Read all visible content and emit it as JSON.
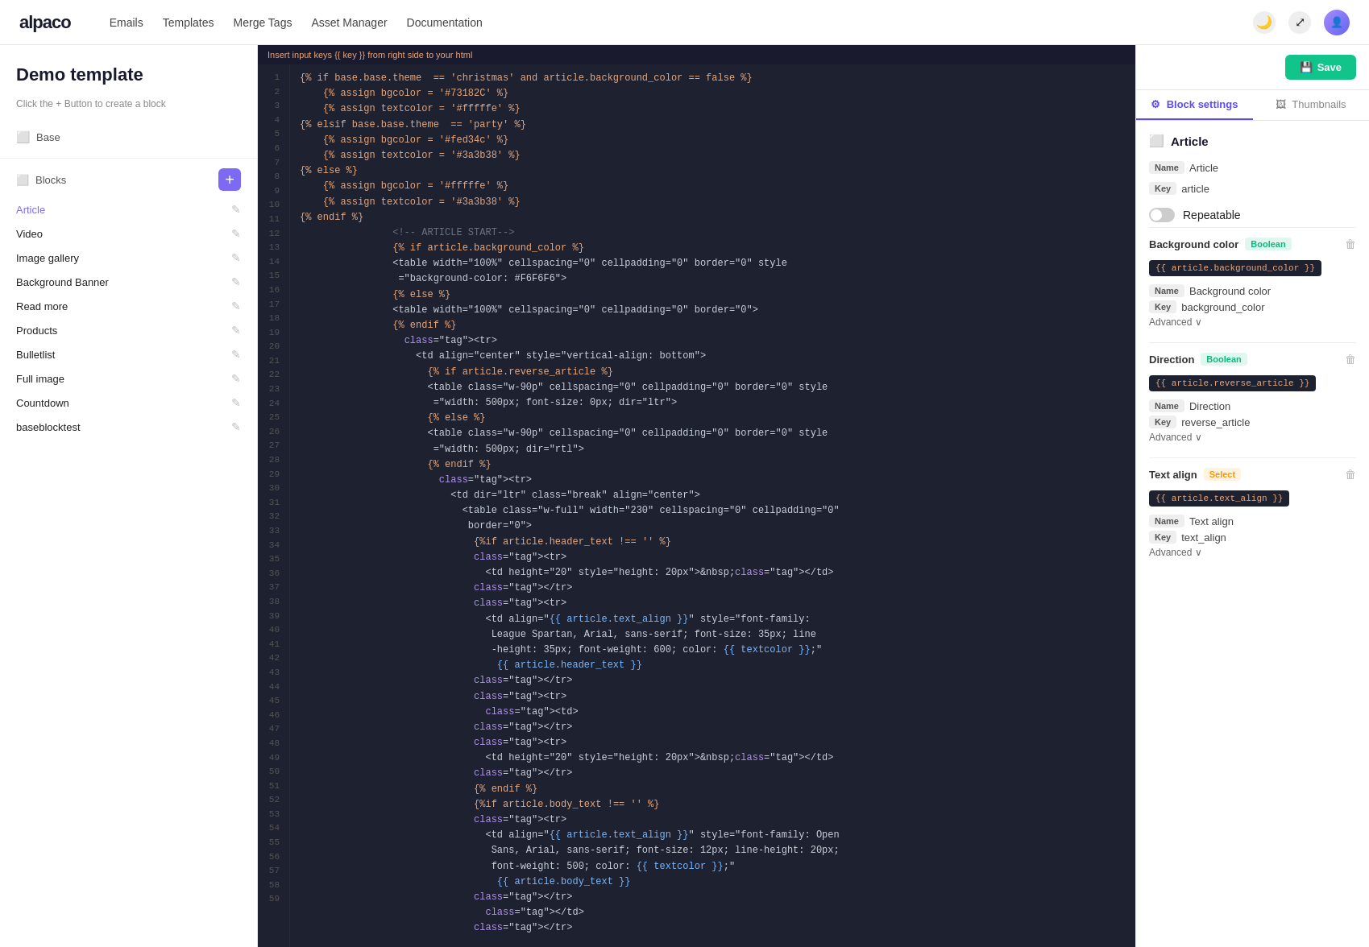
{
  "app": {
    "logo": "alpaco",
    "nav": {
      "links": [
        "Emails",
        "Templates",
        "Merge Tags",
        "Asset Manager",
        "Documentation"
      ]
    }
  },
  "sidebar": {
    "page_title": "Demo template",
    "hint": "Click the + Button to create a block",
    "base_label": "Base",
    "blocks_label": "Blocks",
    "add_button_label": "+",
    "items": [
      {
        "name": "Article",
        "active": true
      },
      {
        "name": "Video",
        "active": false
      },
      {
        "name": "Image gallery",
        "active": false
      },
      {
        "name": "Background Banner",
        "active": false
      },
      {
        "name": "Read more",
        "active": false
      },
      {
        "name": "Products",
        "active": false
      },
      {
        "name": "Bulletlist",
        "active": false
      },
      {
        "name": "Full image",
        "active": false
      },
      {
        "name": "Countdown",
        "active": false
      },
      {
        "name": "baseblocktest",
        "active": false
      }
    ]
  },
  "editor": {
    "hint": "Insert input keys {{ key }} from right side to your html",
    "lines": [
      "{% if base.base.theme  == 'christmas' and article.background_color == false %}",
      "    {% assign bgcolor = '#73182C' %}",
      "    {% assign textcolor = '#fffffe' %}",
      "",
      "{% elsif base.base.theme  == 'party' %}",
      "    {% assign bgcolor = '#fed34c' %}",
      "    {% assign textcolor = '#3a3b38' %}",
      "",
      "{% else %}",
      "    {% assign bgcolor = '#fffffe' %}",
      "    {% assign textcolor = '#3a3b38' %}",
      "{% endif %}",
      "",
      "                <!-- ARTICLE START-->",
      "                {% if article.background_color %}",
      "                <table width=\"100%\" cellspacing=\"0\" cellpadding=\"0\" border=\"0\" style",
      "                 =\"background-color: #F6F6F6\">",
      "                {% else %}",
      "                <table width=\"100%\" cellspacing=\"0\" cellpadding=\"0\" border=\"0\">",
      "                {% endif %}",
      "                  <tr>",
      "                    <td align=\"center\" style=\"vertical-align: bottom\">",
      "                      {% if article.reverse_article %}",
      "                      <table class=\"w-90p\" cellspacing=\"0\" cellpadding=\"0\" border=\"0\" style",
      "                       =\"width: 500px; font-size: 0px; dir=\"ltr\">",
      "                      {% else %}",
      "                      <table class=\"w-90p\" cellspacing=\"0\" cellpadding=\"0\" border=\"0\" style",
      "                       =\"width: 500px; dir=\"rtl\">",
      "                      {% endif %}",
      "                        <tr>",
      "                          <td dir=\"ltr\" class=\"break\" align=\"center\">",
      "                            <table class=\"w-full\" width=\"230\" cellspacing=\"0\" cellpadding=\"0\"",
      "                             border=\"0\">",
      "                              {%if article.header_text !== '' %}",
      "                              <tr>",
      "                                <td height=\"20\" style=\"height: 20px\">&nbsp;</td>",
      "                              </tr>",
      "                              <tr>",
      "                                <td align=\"{{ article.text_align }}\" style=\"font-family:",
      "                                 League Spartan, Arial, sans-serif; font-size: 35px; line",
      "                                 -height: 35px; font-weight: 600; color: {{ textcolor }};\"",
      "                                  {{ article.header_text }}",
      "                              </tr>",
      "                              <tr>",
      "                                <td>",
      "                              </tr>",
      "                              <tr>",
      "                                <td height=\"20\" style=\"height: 20px\">&nbsp;</td>",
      "                              </tr>",
      "                              {% endif %}",
      "                              {%if article.body_text !== '' %}",
      "                              <tr>",
      "                                <td align=\"{{ article.text_align }}\" style=\"font-family: Open",
      "                                 Sans, Arial, sans-serif; font-size: 12px; line-height: 20px;",
      "                                 font-weight: 500; color: {{ textcolor }};\"",
      "                                  {{ article.body_text }}",
      "                              </tr>",
      "                                </td>",
      "                              </tr>"
    ]
  },
  "right_panel": {
    "save_label": "Save",
    "tabs": [
      {
        "label": "Block settings",
        "icon": "⚙",
        "active": true
      },
      {
        "label": "Thumbnails",
        "icon": "🖼",
        "active": false
      }
    ],
    "article_section": {
      "title": "Article",
      "name_label": "Name",
      "name_value": "Article",
      "key_label": "Key",
      "key_value": "article",
      "repeatable_label": "Repeatable"
    },
    "inputs": [
      {
        "id": "background_color",
        "title": "Background color",
        "type_badge": "Boolean",
        "tpl_tag": "{{ article.background_color }}",
        "name_label": "Name",
        "name_value": "Background color",
        "key_label": "Key",
        "key_value": "background_color",
        "advanced_label": "Advanced ∨"
      },
      {
        "id": "direction",
        "title": "Direction",
        "type_badge": "Boolean",
        "tpl_tag": "{{ article.reverse_article }}",
        "name_label": "Name",
        "name_value": "Direction",
        "key_label": "Key",
        "key_value": "reverse_article",
        "advanced_label": "Advanced ∨"
      },
      {
        "id": "text_align",
        "title": "Text align",
        "type_badge": "Select",
        "tpl_tag": "{{ article.text_align }}",
        "name_label": "Name",
        "name_value": "Text align",
        "key_label": "Key",
        "key_value": "text_align",
        "advanced_label": "Advanced ∨"
      }
    ]
  }
}
